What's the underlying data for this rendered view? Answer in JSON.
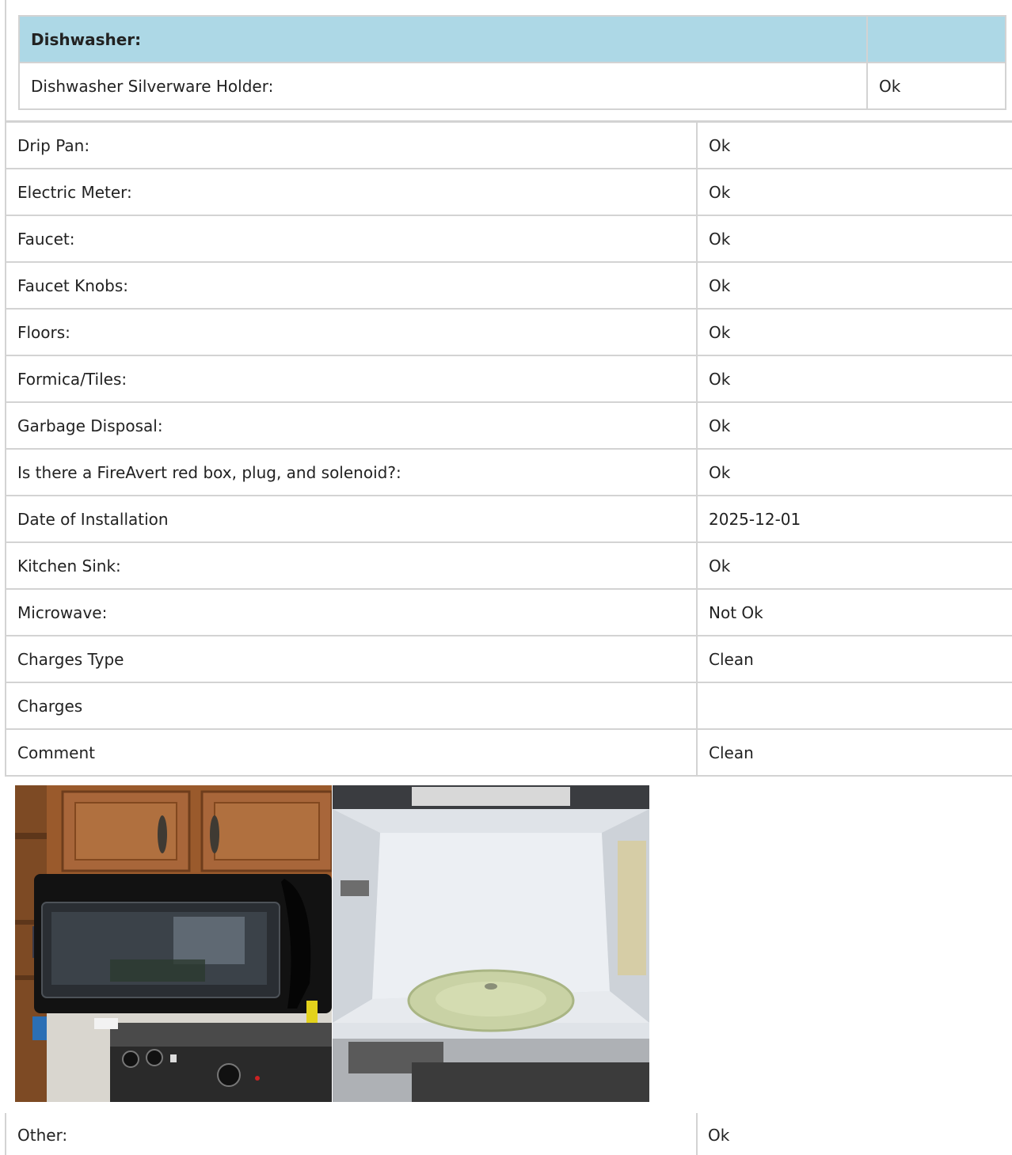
{
  "dishwasher": {
    "header": "Dishwasher:",
    "rows": [
      {
        "label": "Dishwasher Silverware Holder:",
        "value": "Ok"
      }
    ]
  },
  "rows": [
    {
      "label": "Drip Pan:",
      "value": "Ok"
    },
    {
      "label": "Electric Meter:",
      "value": "Ok"
    },
    {
      "label": "Faucet:",
      "value": "Ok"
    },
    {
      "label": "Faucet Knobs:",
      "value": "Ok"
    },
    {
      "label": "Floors:",
      "value": "Ok"
    },
    {
      "label": "Formica/Tiles:",
      "value": "Ok"
    },
    {
      "label": "Garbage Disposal:",
      "value": "Ok"
    },
    {
      "label": "Is there a FireAvert red box, plug, and solenoid?:",
      "value": "Ok"
    },
    {
      "label": "Date of Installation",
      "value": "2025-12-01"
    },
    {
      "label": "Kitchen Sink:",
      "value": "Ok"
    },
    {
      "label": "Microwave:",
      "value": "Not Ok"
    },
    {
      "label": "Charges Type",
      "value": "Clean"
    },
    {
      "label": "Charges",
      "value": ""
    },
    {
      "label": "Comment",
      "value": "Clean"
    }
  ],
  "other": {
    "label": "Other:",
    "value": "Ok"
  },
  "colors": {
    "header_bg": "#add8e6",
    "border": "#d3d3d3"
  }
}
